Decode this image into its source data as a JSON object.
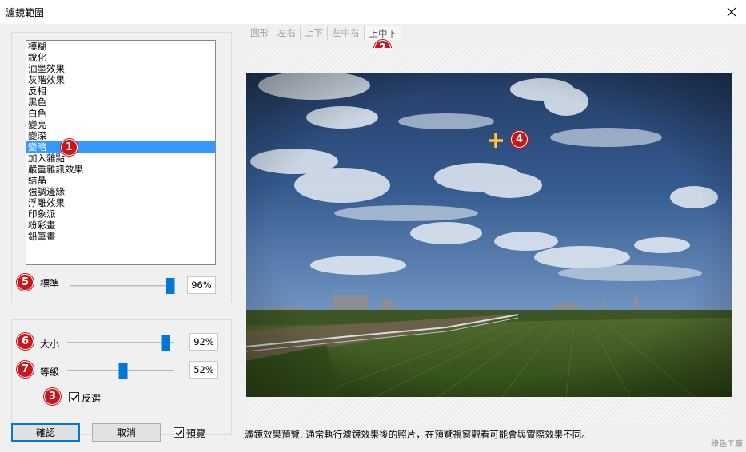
{
  "window": {
    "title": "濾鏡範圍"
  },
  "filter_list": {
    "items": [
      "模糊",
      "銳化",
      "油墨效果",
      "灰階效果",
      "反相",
      "黑色",
      "白色",
      "變亮",
      "變深",
      "變暗",
      "加入雜點",
      "嚴重雜訊效果",
      "結晶",
      "強調邊緣",
      "浮雕效果",
      "印象派",
      "粉彩畫",
      "鉛筆畫"
    ],
    "selected_index": 9
  },
  "standard": {
    "label": "標準",
    "value_text": "96%",
    "value": 0.96
  },
  "size": {
    "label": "大小",
    "value_text": "92%",
    "value": 0.92
  },
  "level": {
    "label": "等級",
    "value_text": "52%",
    "value": 0.52
  },
  "invert": {
    "label": "反選",
    "checked": true
  },
  "buttons": {
    "ok": "確認",
    "cancel": "取消"
  },
  "preview": {
    "label": "預覽",
    "checked": true
  },
  "tabs": [
    "圓形",
    "左右",
    "上下",
    "左中右",
    "上中下"
  ],
  "active_tab": 4,
  "badges": [
    "1",
    "2",
    "3",
    "4",
    "5",
    "6",
    "7"
  ],
  "caption": "濾鏡效果預覽, 通常執行濾鏡效果後的照片，在預覽視窗觀看可能會與實際效果不同。",
  "watermark": "綠色工廠",
  "colors": {
    "accent": "#0078d7",
    "selection": "#3399ff",
    "badge": "#c8161b",
    "crosshair": "#e8a020"
  },
  "icons": {
    "close": "close-icon",
    "crosshair": "crosshair-icon",
    "check": "check-icon"
  }
}
